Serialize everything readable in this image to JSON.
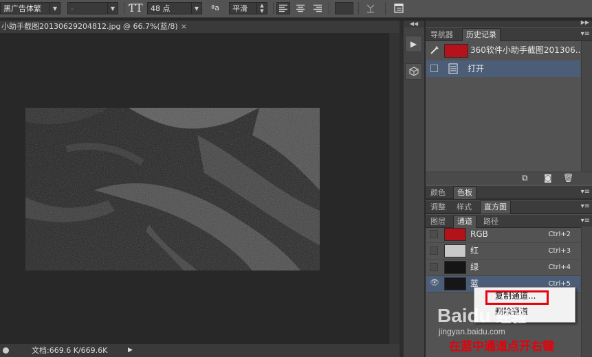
{
  "toolbar": {
    "font_family": "黑广告体繁",
    "font_style": "-",
    "font_size": "48 点",
    "aa_label": "ªa",
    "antialias": "平滑"
  },
  "document": {
    "tab_title": "小助手截图20130629204812.jpg @ 66.7%(蓝/8)",
    "close": "×"
  },
  "status": {
    "doc_info": "文档:669.6 K/669.6K"
  },
  "history_panel": {
    "tabs": [
      "导航器",
      "历史记录"
    ],
    "snapshot_name": "360软件小助手截图201306...",
    "step_open": "打开",
    "snapshot_color": "#b5121b"
  },
  "color_panel": {
    "tabs": [
      "颜色",
      "色板"
    ]
  },
  "adjust_panel": {
    "tabs": [
      "调整",
      "样式",
      "直方图"
    ]
  },
  "channels_panel": {
    "tabs": [
      "图层",
      "通道",
      "路径"
    ],
    "channels": [
      {
        "name": "RGB",
        "shortcut": "Ctrl+2",
        "thumb_color": "#b3121a"
      },
      {
        "name": "红",
        "shortcut": "Ctrl+3",
        "thumb_color": "#c9c9c9"
      },
      {
        "name": "绿",
        "shortcut": "Ctrl+4",
        "thumb_color": "#151515"
      },
      {
        "name": "蓝",
        "shortcut": "Ctrl+5",
        "thumb_color": "#161616"
      }
    ]
  },
  "context_menu": {
    "duplicate": "复制通道...",
    "delete": "删除通道",
    "highlight_color": "#e8000b"
  },
  "watermark": {
    "brand": "Baidu",
    "brand_cn": "经验",
    "url": "jingyan.baidu.com"
  },
  "annotation": {
    "text": "在蓝中通道点开右键",
    "color": "#e8000b"
  }
}
